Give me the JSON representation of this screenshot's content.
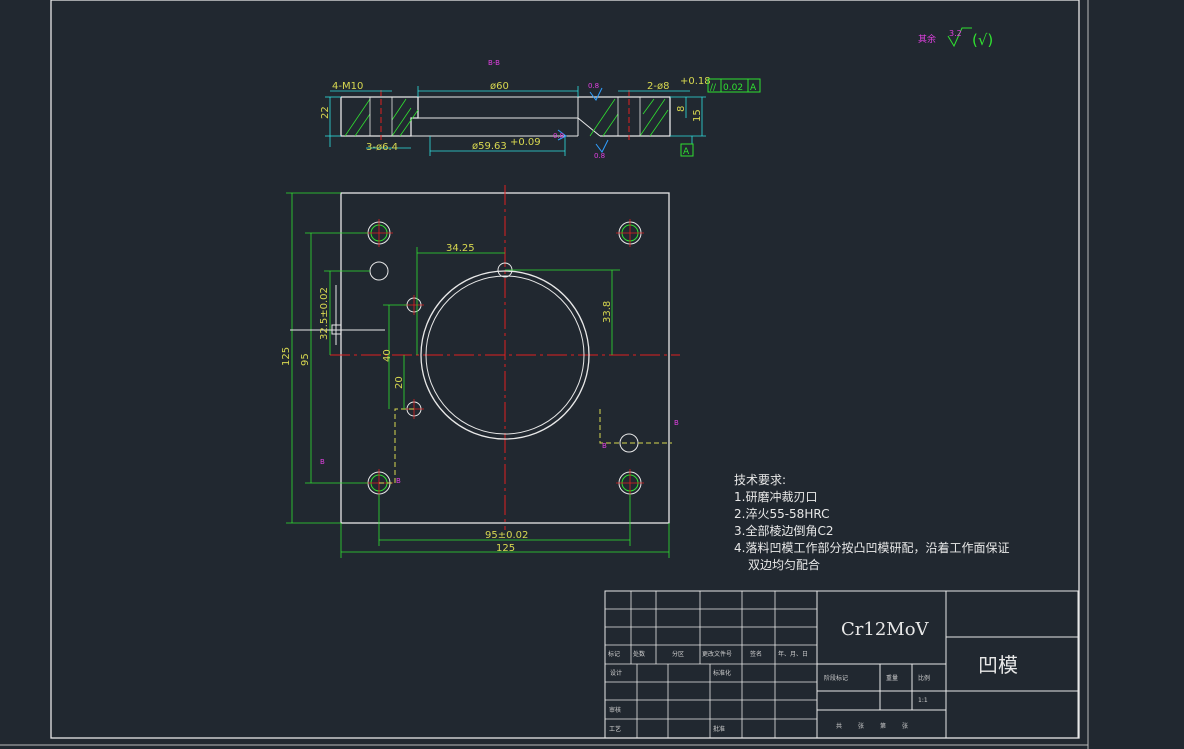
{
  "drawing": {
    "section_label": "B-B",
    "finish_symbol": {
      "prefix": "其余",
      "value": "3.2",
      "paren": "(√)"
    },
    "top_view_dims": {
      "thread": "4-M10",
      "dia60": "ø60",
      "dia59": "ø59.63",
      "dia59_tol": "+0.09",
      "holes_small": "3-ø6.4",
      "pins": "2-ø8",
      "pins_tol": "+0.18",
      "h22": "22",
      "h8": "8",
      "h15": "15",
      "rough1": "0.8",
      "rough2": "0.8",
      "rough3": "0.8"
    },
    "tolerance_frame": {
      "symbol": "//",
      "value": "0.02",
      "datum": "A"
    },
    "datum_label": "A",
    "plan_dims": {
      "d34_25": "34.25",
      "d33_8": "33.8",
      "d125_v": "125",
      "d95_v": "95",
      "d32_5": "32.5±0.02",
      "d40": "40",
      "d20": "20",
      "d95_h": "95±0.02",
      "d125_h": "125",
      "cut_b1": "B",
      "cut_b2": "B",
      "cut_b3": "B",
      "cut_b4": "B"
    },
    "tech_requirements": {
      "title": "技术要求:",
      "items": [
        "1.研磨冲裁刃口",
        "2.淬火55-58HRC",
        "3.全部棱边倒角C2",
        "4.落料凹模工作部分按凸凹模研配，沿着工作面保证",
        "双边均匀配合"
      ]
    },
    "title_block": {
      "material": "Cr12MoV",
      "part_name": "凹模",
      "row_labels": [
        "标记",
        "处数",
        "分区",
        "更改文件号",
        "签名",
        "年、月、日"
      ],
      "design": "设计",
      "standardize": "标准化",
      "review": "审核",
      "process": "工艺",
      "approve": "批准",
      "stage_mark": "阶段标记",
      "weight": "重量",
      "scale": "比例",
      "scale_value": "1:1",
      "sheets": [
        "共",
        "张",
        "第",
        "张"
      ]
    }
  }
}
